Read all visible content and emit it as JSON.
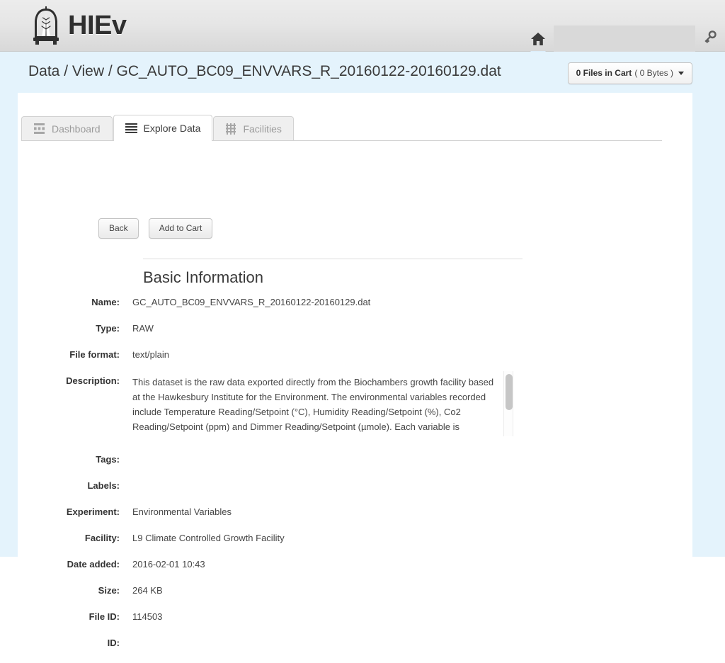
{
  "header": {
    "brand_name": "HIEv",
    "logo_icon": "chamber-tree-logo",
    "home_icon": "home-icon",
    "user_name": "",
    "key_icon": "key-icon"
  },
  "breadcrumb": {
    "text": "Data / View / GC_AUTO_BC09_ENVVARS_R_20160122-20160129.dat"
  },
  "cart": {
    "files_label": "0 Files in Cart",
    "size_label": "( 0 Bytes )",
    "caret_icon": "chevron-down-icon"
  },
  "tabs": [
    {
      "label": "Dashboard",
      "icon": "dashboard-icon",
      "active": false
    },
    {
      "label": "Explore Data",
      "icon": "list-icon",
      "active": true
    },
    {
      "label": "Facilities",
      "icon": "facilities-building-icon",
      "active": false
    }
  ],
  "actions": {
    "back_label": "Back",
    "add_to_cart_label": "Add to Cart"
  },
  "section": {
    "title": "Basic Information"
  },
  "fields": {
    "name_label": "Name:",
    "name_value": "GC_AUTO_BC09_ENVVARS_R_20160122-20160129.dat",
    "type_label": "Type:",
    "type_value": "RAW",
    "file_format_label": "File format:",
    "file_format_value": "text/plain",
    "description_label": "Description:",
    "description_value": "This dataset is the raw data exported directly from the Biochambers growth facility based at the Hawkesbury Institute for the Environment. The environmental variables recorded include Temperature Reading/Setpoint (°C), Humidity Reading/Setpoint (%), Co2 Reading/Setpoint (ppm) and Dimmer Reading/Setpoint (µmole). Each variable is",
    "tags_label": "Tags:",
    "tags_value": "",
    "labels_label": "Labels:",
    "labels_value": "",
    "experiment_label": "Experiment:",
    "experiment_value": "Environmental Variables",
    "facility_label": "Facility:",
    "facility_value": "L9 Climate Controlled Growth Facility",
    "date_added_label": "Date added:",
    "date_added_value": "2016-02-01 10:43",
    "size_label": "Size:",
    "size_value": "264 KB",
    "file_id_label": "File ID:",
    "file_id_value": "114503",
    "id_label": "ID:",
    "id_value": ""
  },
  "colors": {
    "page_background": "#e4f3fc",
    "header_gradient_top": "#ececec",
    "header_gradient_bottom": "#d8d8d8",
    "card_background": "#ffffff",
    "text_primary": "#333333",
    "text_muted": "#9b9b9b"
  }
}
